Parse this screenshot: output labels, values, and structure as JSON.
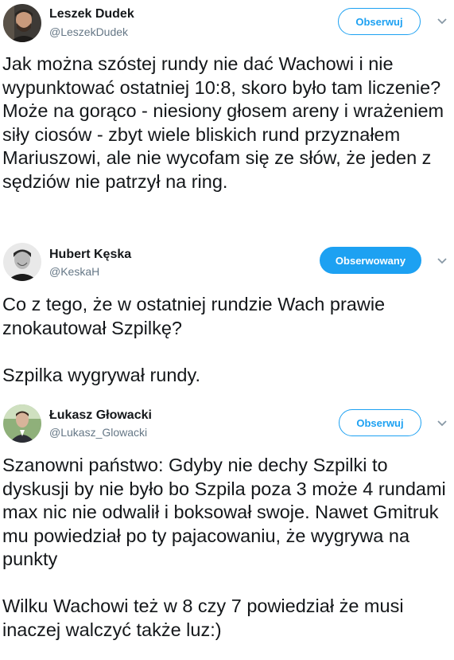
{
  "tweets": [
    {
      "author_name": "Leszek Dudek",
      "author_handle": "@LeszekDudek",
      "follow_label": "Obserwuj",
      "follow_state": "outline",
      "text": "Jak można szóstej rundy nie dać Wachowi i nie wypunktować ostatniej 10:8, skoro było tam liczenie? Może na gorąco - niesiony głosem areny i wrażeniem siły ciosów - zbyt wiele bliskich rund przyznałem Mariuszowi, ale nie wycofam się ze słów, że jeden z sędziów nie patrzył na ring."
    },
    {
      "author_name": "Hubert Kęska",
      "author_handle": "@KeskaH",
      "follow_label": "Obserwowany",
      "follow_state": "filled",
      "text": "Co z tego, że w ostatniej rundzie Wach prawie znokautował Szpilkę?\n\nSzpilka wygrywał rundy."
    },
    {
      "author_name": "Łukasz Głowacki",
      "author_handle": "@Lukasz_Glowacki",
      "follow_label": "Obserwuj",
      "follow_state": "outline",
      "text": "Szanowni państwo: Gdyby nie dechy Szpilki to dyskusji by nie było bo Szpila poza 3 może 4 rundami max nic nie odwalił i boksował swoje. Nawet Gmitruk mu powiedział po ty pajacowaniu, że wygrywa na punkty\n\nWilku Wachowi też w 8 czy 7 powiedział że musi inaczej walczyć także luz:)"
    }
  ],
  "colors": {
    "accent": "#1da1f2",
    "handle": "#657786",
    "text": "#14171a"
  }
}
